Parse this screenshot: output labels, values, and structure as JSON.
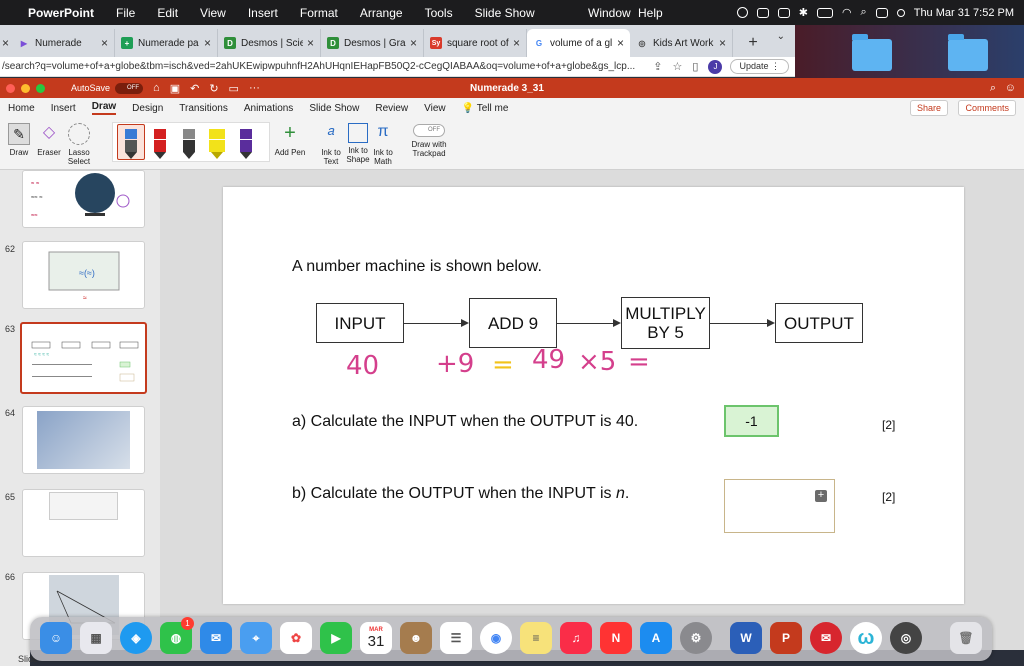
{
  "menubar": {
    "app": "PowerPoint",
    "items": [
      "File",
      "Edit",
      "View",
      "Insert",
      "Format",
      "Arrange",
      "Tools",
      "Slide Show"
    ],
    "right_items": [
      "Window",
      "Help"
    ],
    "clock": "Thu Mar 31  7:52 PM"
  },
  "browser": {
    "tabs": [
      {
        "label": "Numerade",
        "color": "#7b4fd8",
        "glyph": "▶"
      },
      {
        "label": "Numerade pa",
        "color": "#1e9e55",
        "glyph": "+"
      },
      {
        "label": "Desmos | Scie",
        "color": "#2f8f3a",
        "glyph": "D"
      },
      {
        "label": "Desmos | Grap",
        "color": "#2f8f3a",
        "glyph": "D"
      },
      {
        "label": "square root of",
        "color": "#d93a2b",
        "glyph": "Sy"
      },
      {
        "label": "volume of a gl",
        "color": "#ffffff",
        "glyph": "G"
      },
      {
        "label": "Kids Art Work",
        "color": "#666666",
        "glyph": "◎"
      }
    ],
    "active_tab_index": 5,
    "url": "/search?q=volume+of+a+globe&tbm=isch&ved=2ahUKEwipwpuhnfH2AhUHqnIEHapFB50Q2-cCegQIABAA&oq=volume+of+a+globe&gs_lcp...",
    "avatar": "J",
    "update_label": "Update"
  },
  "ppt": {
    "autosave_label": "AutoSave",
    "autosave_state": "OFF",
    "doc_title": "Numerade 3_31",
    "ribbon_tabs": [
      "Home",
      "Insert",
      "Draw",
      "Design",
      "Transitions",
      "Animations",
      "Slide Show",
      "Review",
      "View",
      "Tell me"
    ],
    "active_ribbon_tab": "Draw",
    "share_label": "Share",
    "comments_label": "Comments",
    "ribbon": {
      "draw": "Draw",
      "eraser": "Eraser",
      "lasso": "Lasso Select",
      "add_pen": "Add Pen",
      "ink_to_text": "Ink to Text",
      "ink_to_shape": "Ink to Shape",
      "ink_to_math": "Ink to Math",
      "trackpad_toggle": "OFF",
      "draw_with_trackpad": "Draw with Trackpad",
      "pens": [
        {
          "color": "#3a7bd5",
          "selected": true
        },
        {
          "color": "#d42020",
          "selected": false
        },
        {
          "color": "#222222",
          "selected": false
        },
        {
          "color": "#f2e21a",
          "selected": false
        },
        {
          "color": "#5a2d9c",
          "selected": false
        }
      ]
    },
    "slide_numbers": [
      "62",
      "63",
      "64",
      "65",
      "66"
    ],
    "selected_slide": "63",
    "status_left": "Slide"
  },
  "slide": {
    "title": "A number machine is shown below.",
    "boxes": [
      "INPUT",
      "ADD 9",
      "MULTIPLY BY 5",
      "OUTPUT"
    ],
    "handwriting": {
      "input_value": "40",
      "plus_nine": "+9",
      "equals1": "=",
      "result": "49",
      "times_five": "×5",
      "equals2": "="
    },
    "question_a": "a) Calculate the INPUT when the OUTPUT is 40.",
    "answer_a": "-1",
    "marks_a": "[2]",
    "question_b_prefix": "b) Calculate the OUTPUT when the INPUT is ",
    "question_b_var": "n",
    "question_b_suffix": ".",
    "answer_b": "",
    "marks_b": "[2]"
  },
  "dock": {
    "calendar_month": "MAR",
    "calendar_day": "31",
    "notification_badge": "1"
  }
}
